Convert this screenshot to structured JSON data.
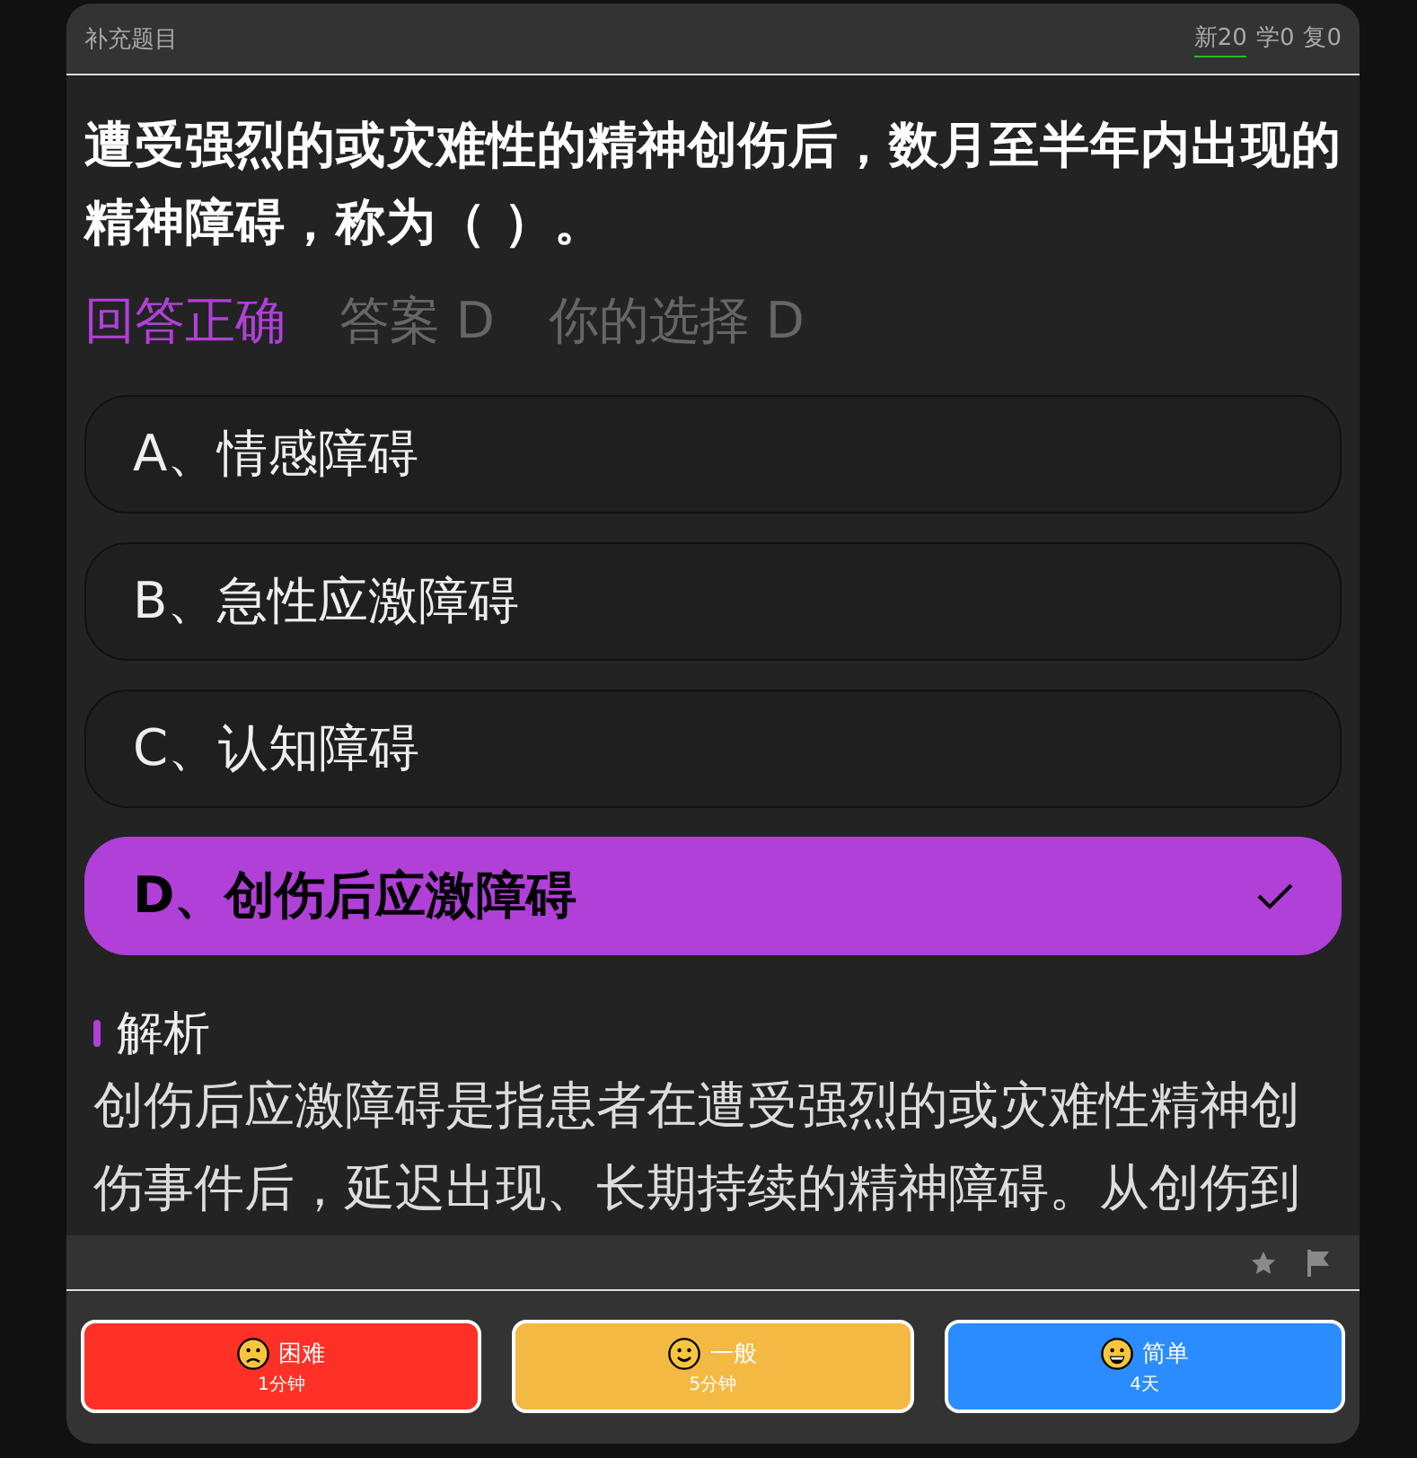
{
  "header": {
    "title": "补充题目",
    "counters": [
      {
        "label": "新20",
        "selected": true
      },
      {
        "label": "学0",
        "selected": false
      },
      {
        "label": "复0",
        "selected": false
      }
    ]
  },
  "question": {
    "text": "遭受强烈的或灾难性的精神创伤后，数月至半年内出现的精神障碍，称为（ ）。",
    "correct": true,
    "result": "回答正确",
    "answer": "答案 D",
    "your_choice": "你的选择 D",
    "options": [
      {
        "label": "A、情感障碍",
        "selected": false
      },
      {
        "label": "B、急性应激障碍",
        "selected": false
      },
      {
        "label": "C、认知障碍",
        "selected": false
      },
      {
        "label": "D、创伤后应激障碍",
        "selected": true
      }
    ]
  },
  "analysis": {
    "title": "解析",
    "text": "创伤后应激障碍是指患者在遭受强烈的或灾难性精神创伤事件后，延迟出现、长期持续的精神障碍。从创伤到"
  },
  "ratings": [
    {
      "kind": "hard",
      "label": "困难",
      "interval": "1分钟",
      "color": "#ff3025"
    },
    {
      "kind": "normal",
      "label": "一般",
      "interval": "5分钟",
      "color": "#f4b942"
    },
    {
      "kind": "easy",
      "label": "简单",
      "interval": "4天",
      "color": "#2a8cff"
    }
  ]
}
